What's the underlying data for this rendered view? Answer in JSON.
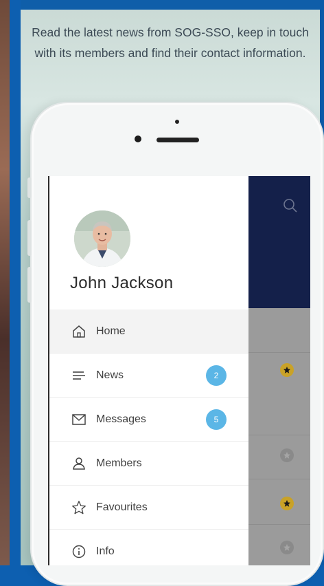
{
  "tagline": "Read the latest news from SOG-SSO, keep in touch with its members and find their contact information.",
  "user": {
    "name": "John Jackson"
  },
  "menu": [
    {
      "label": "Home",
      "icon": "home-icon",
      "badge": ""
    },
    {
      "label": "News",
      "icon": "news-icon",
      "badge": "2"
    },
    {
      "label": "Messages",
      "icon": "envelope-icon",
      "badge": "5"
    },
    {
      "label": "Members",
      "icon": "person-icon",
      "badge": ""
    },
    {
      "label": "Favourites",
      "icon": "star-icon",
      "badge": ""
    },
    {
      "label": "Info",
      "icon": "info-icon",
      "badge": ""
    }
  ],
  "colors": {
    "header": "#14204a",
    "badge": "#5bb6e6",
    "star_active": "#c9a227",
    "star_inactive": "#8a8a8a"
  }
}
